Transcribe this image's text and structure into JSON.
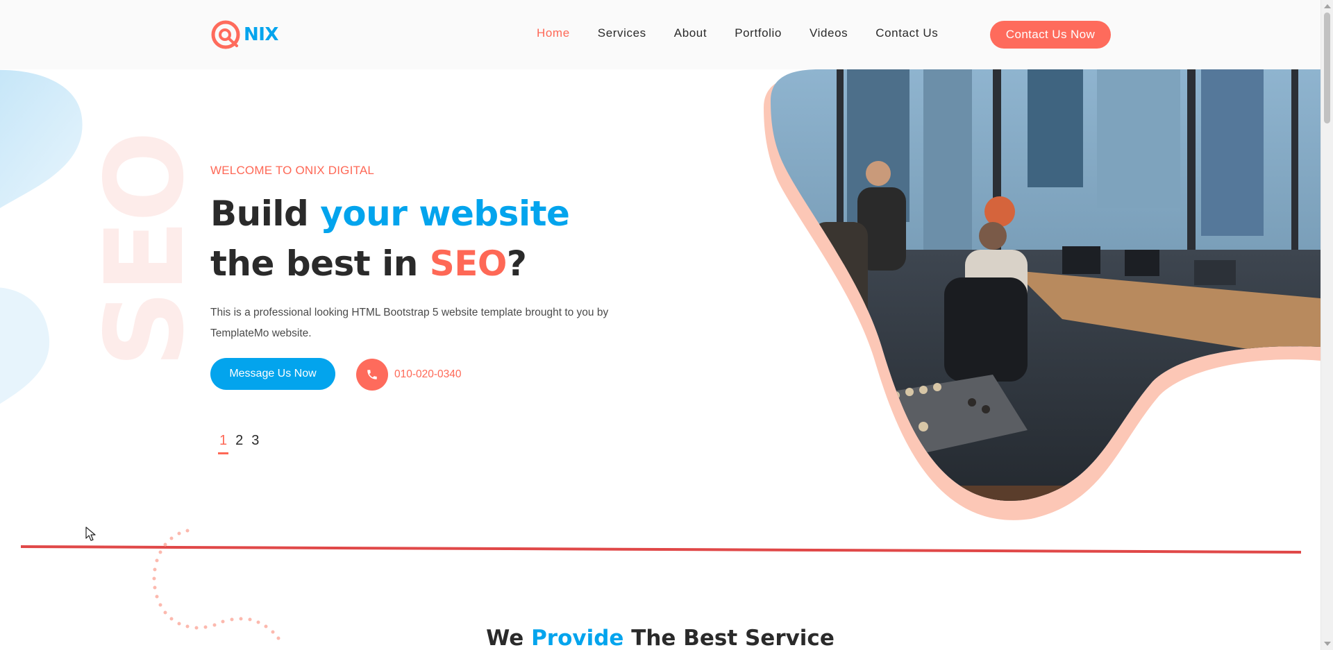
{
  "brand": {
    "logo_text": "NIX"
  },
  "nav": {
    "items": [
      {
        "label": "Home",
        "active": true
      },
      {
        "label": "Services",
        "active": false
      },
      {
        "label": "About",
        "active": false
      },
      {
        "label": "Portfolio",
        "active": false
      },
      {
        "label": "Videos",
        "active": false
      },
      {
        "label": "Contact Us",
        "active": false
      }
    ],
    "cta_label": "Contact Us Now"
  },
  "hero": {
    "eyebrow": "WELCOME TO ONIX DIGITAL",
    "headline": {
      "part1": "Build ",
      "highlight1": "your website",
      "part2": " the best in ",
      "highlight2": "SEO",
      "part3": "?"
    },
    "watermark": "SEO",
    "description": "This is a professional looking HTML Bootstrap 5 website template brought to you by TemplateMo website.",
    "primary_button": "Message Us Now",
    "phone": "010-020-0340",
    "pager": [
      "1",
      "2",
      "3"
    ],
    "pager_active": "1",
    "image_alt": "office team working at desks by window"
  },
  "section": {
    "title_part1": "We ",
    "title_highlight": "Provide",
    "title_part2": " The Best Service"
  },
  "colors": {
    "accent_red": "#fe6856",
    "accent_blue": "#03a4ed",
    "text_dark": "#2a2a2a"
  },
  "icons": [
    "logo-icon",
    "phone-icon",
    "cursor-icon"
  ]
}
